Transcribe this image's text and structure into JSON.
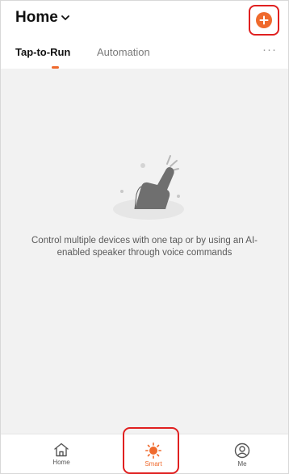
{
  "header": {
    "title": "Home",
    "add_icon": "plus-circle-icon",
    "accent_color": "#ef6a2d",
    "highlight_color": "#e02020"
  },
  "tabs": {
    "items": [
      {
        "label": "Tap-to-Run",
        "active": true
      },
      {
        "label": "Automation",
        "active": false
      }
    ],
    "more_label": "···"
  },
  "empty_state": {
    "illustration_icon": "tap-hand-illustration",
    "message": "Control multiple devices with one tap or by using an AI-enabled speaker through voice commands"
  },
  "tabbar": {
    "items": [
      {
        "label": "Home",
        "icon": "house-icon",
        "selected": false
      },
      {
        "label": "Smart",
        "icon": "sun-icon",
        "selected": true
      },
      {
        "label": "Me",
        "icon": "user-icon",
        "selected": false
      }
    ]
  }
}
